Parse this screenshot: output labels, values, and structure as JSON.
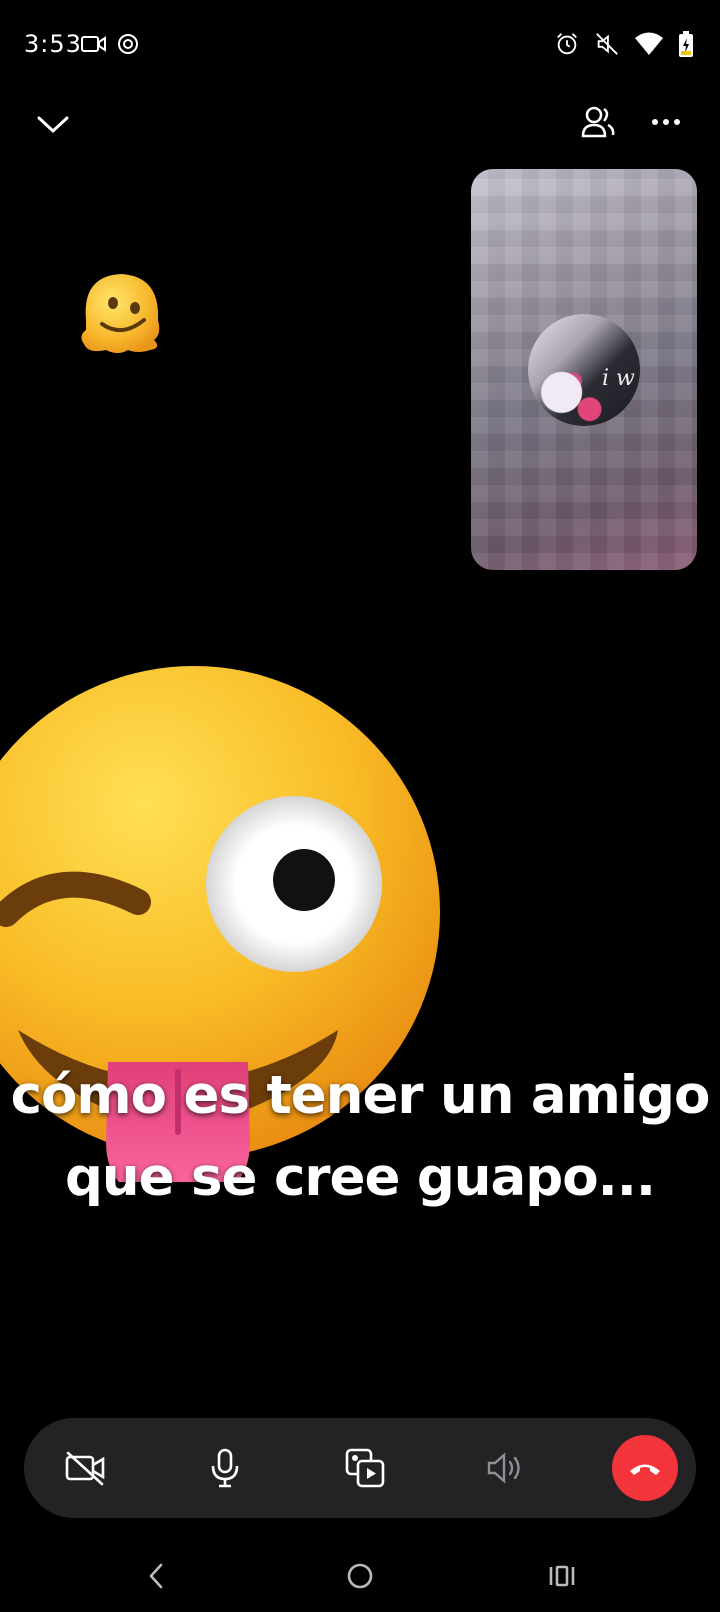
{
  "status_bar": {
    "time": "3:53",
    "icons": [
      "video-record-icon",
      "focus-ring-icon",
      "alarm-icon",
      "mute-icon",
      "wifi-icon",
      "battery-charging-icon"
    ]
  },
  "top_bar": {
    "icons": [
      "chevron-down-icon",
      "add-people-icon",
      "more-dots-icon"
    ]
  },
  "self_view": {
    "avatar_text": "i w"
  },
  "stickers": [
    "melting-face-emoji",
    "winking-face-with-tongue-emoji"
  ],
  "caption": {
    "line1": "cómo es tener un amigo",
    "line2": "que se cree guapo..."
  },
  "controls": {
    "icons": [
      "camera-off-icon",
      "microphone-icon",
      "share-media-icon",
      "speaker-icon",
      "end-call-icon"
    ],
    "end_call_color": "#f3343b",
    "bar_color": "#232325"
  },
  "nav_bar": {
    "icons": [
      "back-icon",
      "home-icon",
      "recents-icon"
    ]
  }
}
